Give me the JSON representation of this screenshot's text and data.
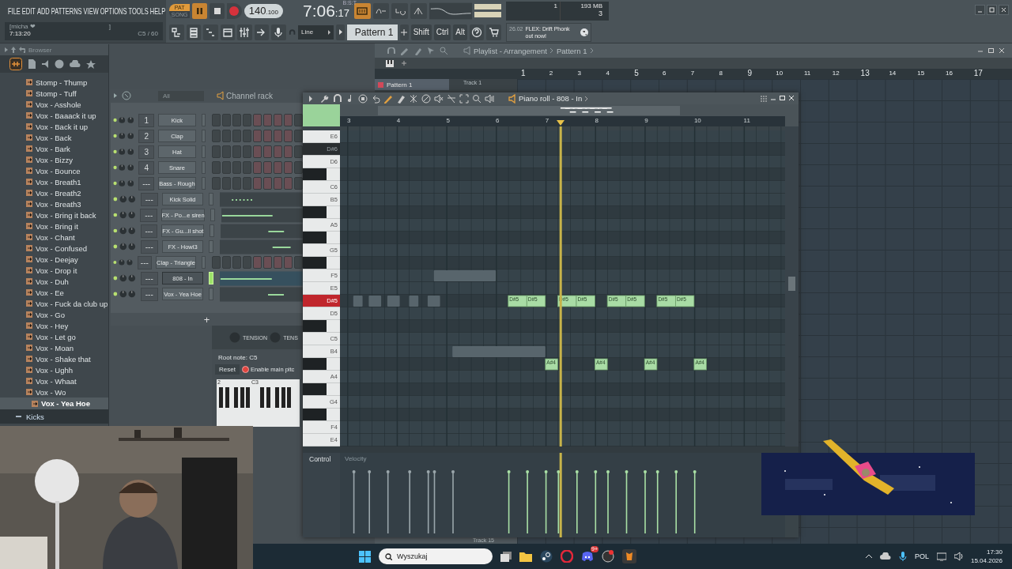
{
  "menu": [
    "FILE",
    "EDIT",
    "ADD",
    "PATTERNS",
    "VIEW",
    "OPTIONS",
    "TOOLS",
    "HELP"
  ],
  "hint": {
    "title": "[micha ❤",
    "bracket": "]",
    "time": "7:13:20",
    "note": "C5 / 60"
  },
  "transport": {
    "modes": [
      {
        "label": "PAT",
        "selected": true
      },
      {
        "label": "SONG",
        "selected": false
      }
    ],
    "playing": true,
    "tempo": "140",
    "tempo_fraction": ".100"
  },
  "clock": {
    "time": "7:06",
    "seconds": ":17",
    "unit": "B:S:T"
  },
  "cpu": {
    "cpu": "1",
    "memory": "193 MB",
    "polyphony": "3"
  },
  "snap": "Line",
  "pattern": "Pattern 1",
  "modifier_keys": [
    "Shift",
    "Ctrl",
    "Alt"
  ],
  "news": {
    "date": "26.02",
    "text": "FLEX: Drift Phonk out now!"
  },
  "browser": {
    "title": "Browser",
    "items": [
      {
        "label": "Stomp - Thump",
        "selected": false
      },
      {
        "label": "Stomp - Tuff",
        "selected": false
      },
      {
        "label": "Vox - Asshole",
        "selected": false
      },
      {
        "label": "Vox - Baaack it up",
        "selected": false
      },
      {
        "label": "Vox - Back it up",
        "selected": false
      },
      {
        "label": "Vox - Back",
        "selected": false
      },
      {
        "label": "Vox - Bark",
        "selected": false
      },
      {
        "label": "Vox - Bizzy",
        "selected": false
      },
      {
        "label": "Vox - Bounce",
        "selected": false
      },
      {
        "label": "Vox - Breath1",
        "selected": false
      },
      {
        "label": "Vox - Breath2",
        "selected": false
      },
      {
        "label": "Vox - Breath3",
        "selected": false
      },
      {
        "label": "Vox - Bring it back",
        "selected": false
      },
      {
        "label": "Vox - Bring it",
        "selected": false
      },
      {
        "label": "Vox - Chant",
        "selected": false
      },
      {
        "label": "Vox - Confused",
        "selected": false
      },
      {
        "label": "Vox - Deejay",
        "selected": false
      },
      {
        "label": "Vox - Drop it",
        "selected": false
      },
      {
        "label": "Vox - Duh",
        "selected": false
      },
      {
        "label": "Vox - Ee",
        "selected": false
      },
      {
        "label": "Vox - Fuck da club up",
        "selected": false
      },
      {
        "label": "Vox - Go",
        "selected": false
      },
      {
        "label": "Vox - Hey",
        "selected": false
      },
      {
        "label": "Vox - Let go",
        "selected": false
      },
      {
        "label": "Vox - Moan",
        "selected": false
      },
      {
        "label": "Vox - Shake that",
        "selected": false
      },
      {
        "label": "Vox - Ughh",
        "selected": false
      },
      {
        "label": "Vox - Whaat",
        "selected": false
      },
      {
        "label": "Vox - Wo",
        "selected": false
      },
      {
        "label": "Vox - Yea Hoe",
        "selected": true
      }
    ],
    "folder": "Kicks"
  },
  "channel_rack": {
    "filter": "All",
    "title": "Channel rack",
    "add": "+",
    "channels": [
      {
        "number": "1",
        "name": "Kick",
        "kind": "steps",
        "selected": false
      },
      {
        "number": "2",
        "name": "Clap",
        "kind": "steps",
        "selected": false
      },
      {
        "number": "3",
        "name": "Hat",
        "kind": "steps",
        "selected": false
      },
      {
        "number": "4",
        "name": "Snare",
        "kind": "steps",
        "selected": false
      },
      {
        "number": "---",
        "name": "Bass - Rough",
        "kind": "steps",
        "selected": false
      },
      {
        "number": "---",
        "name": "Kick Solid",
        "kind": "notes",
        "selected": false
      },
      {
        "number": "---",
        "name": "FX - Po...e siren",
        "kind": "notes",
        "selected": false
      },
      {
        "number": "---",
        "name": "FX - Gu...ll shot",
        "kind": "notes",
        "selected": false
      },
      {
        "number": "---",
        "name": "FX - Howl3",
        "kind": "notes",
        "selected": false
      },
      {
        "number": "---",
        "name": "Clap - Triangle",
        "kind": "steps",
        "selected": false
      },
      {
        "number": "---",
        "name": "808 - In",
        "kind": "notes",
        "selected": true
      },
      {
        "number": "---",
        "name": "Vox - Yea Hoe",
        "kind": "notes",
        "selected": false
      }
    ]
  },
  "channel_settings": {
    "knobs": [
      "TENSION",
      "TENS"
    ],
    "root_note": "Root note: C5",
    "reset": "Reset",
    "enable_pitch": {
      "label": "Enable main pitc",
      "checked": true
    },
    "keyboard_labels": [
      "2",
      "C3"
    ]
  },
  "piano_roll": {
    "title": "Piano roll - 808 - In",
    "bars": [
      "3",
      "4",
      "5",
      "6",
      "7",
      "8",
      "9",
      "10",
      "11"
    ],
    "keys": [
      {
        "label": "E6",
        "kind": "white",
        "highlighted": false,
        "selected": false
      },
      {
        "label": "D#6",
        "kind": "black",
        "highlighted": true,
        "selected": false
      },
      {
        "label": "D6",
        "kind": "white",
        "highlighted": false,
        "selected": false
      },
      {
        "kind": "black",
        "highlighted": false,
        "selected": false
      },
      {
        "label": "C6",
        "kind": "white",
        "highlighted": false,
        "selected": false
      },
      {
        "label": "B5",
        "kind": "white",
        "highlighted": false,
        "selected": false
      },
      {
        "kind": "black",
        "highlighted": false,
        "selected": false
      },
      {
        "label": "A5",
        "kind": "white",
        "highlighted": false,
        "selected": false
      },
      {
        "kind": "black",
        "highlighted": false,
        "selected": false
      },
      {
        "label": "G5",
        "kind": "white",
        "highlighted": false,
        "selected": false
      },
      {
        "kind": "black",
        "highlighted": false,
        "selected": false
      },
      {
        "label": "F5",
        "kind": "white",
        "highlighted": false,
        "selected": false
      },
      {
        "label": "E5",
        "kind": "white",
        "highlighted": false,
        "selected": false
      },
      {
        "label": "D#5",
        "kind": "black",
        "highlighted": false,
        "selected": true
      },
      {
        "label": "D5",
        "kind": "white",
        "highlighted": false,
        "selected": false
      },
      {
        "kind": "black",
        "highlighted": false,
        "selected": false
      },
      {
        "label": "C5",
        "kind": "white",
        "highlighted": false,
        "selected": false
      },
      {
        "label": "B4",
        "kind": "white",
        "highlighted": false,
        "selected": false
      },
      {
        "kind": "black",
        "highlighted": false,
        "selected": false
      },
      {
        "label": "A4",
        "kind": "white",
        "highlighted": false,
        "selected": false
      },
      {
        "kind": "black",
        "highlighted": false,
        "selected": false
      },
      {
        "label": "G4",
        "kind": "white",
        "highlighted": false,
        "selected": false
      },
      {
        "kind": "black",
        "highlighted": false,
        "selected": false
      },
      {
        "label": "F4",
        "kind": "white",
        "highlighted": false,
        "selected": false
      },
      {
        "label": "E4",
        "kind": "white",
        "highlighted": false,
        "selected": false
      }
    ],
    "notes": [
      {
        "label": "D#5"
      },
      {
        "label": "D#5"
      },
      {
        "label": "A#4"
      },
      {
        "label": "D#5"
      },
      {
        "label": "D#5"
      },
      {
        "label": "A#4"
      },
      {
        "label": "D#5"
      },
      {
        "label": "D#5"
      },
      {
        "label": "A#4"
      },
      {
        "label": "D#5"
      },
      {
        "label": "D#5"
      },
      {
        "label": "A#4"
      }
    ],
    "playhead": {
      "level": 0.496
    },
    "control": "Control",
    "control_target": "Velocity"
  },
  "playlist": {
    "title": "Playlist - Arrangement",
    "pattern": "Pattern 1",
    "bars": [
      "1",
      "2",
      "3",
      "4",
      "5",
      "6",
      "7",
      "8",
      "9",
      "10",
      "11",
      "12",
      "13",
      "14",
      "15",
      "16",
      "17"
    ],
    "clip_label": "Pattern 1",
    "track_labels": [
      "Track 1",
      "Track 15"
    ]
  },
  "taskbar": {
    "search": {
      "placeholder": "Wyszukaj"
    },
    "badge": "9+",
    "language": "POL",
    "time": "17:30",
    "date": "15.04.2026"
  }
}
